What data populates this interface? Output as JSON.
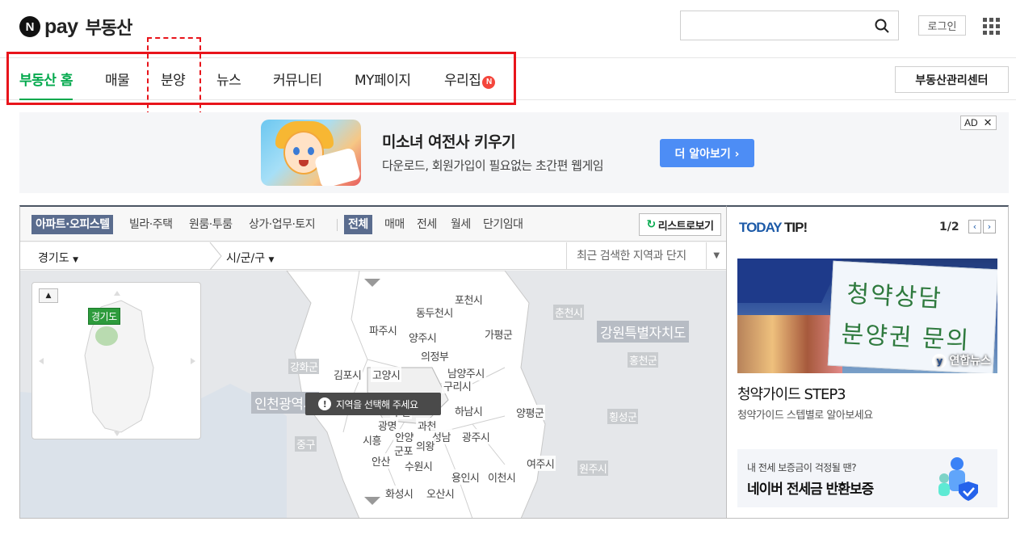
{
  "header": {
    "logo_n": "N",
    "logo_pay": "pay",
    "logo_service": "부동산",
    "search_placeholder": "",
    "login": "로그인"
  },
  "nav": {
    "items": [
      "부동산 홈",
      "매물",
      "분양",
      "뉴스",
      "커뮤니티",
      "MY페이지",
      "우리집"
    ],
    "active_index": 0,
    "badge": "N",
    "management_center": "부동산관리센터"
  },
  "ad": {
    "title": "미소녀 여전사 키우기",
    "description": "다운로드, 회원가입이 필요없는 초간편 웹게임",
    "cta": "더 알아보기 ›",
    "badge": "AD",
    "close": "✕"
  },
  "map_panel": {
    "filters_type": [
      "아파트·오피스텔",
      "빌라·주택",
      "원룸·투룸",
      "상가·업무·토지"
    ],
    "filters_deal": [
      "전체",
      "매매",
      "전세",
      "월세",
      "단기임대"
    ],
    "list_button": "리스트로보기",
    "list_icon": "↻",
    "province": "경기도",
    "city": "시/군/구",
    "recent_search": "최근 검색한 지역과 단지",
    "mini_map_tag": "경기도",
    "mini_map_up": "▲",
    "tooltip": "지역을 선택해 주세요",
    "tooltip_icon": "!",
    "cities": {
      "pocheon": "포천시",
      "dongducheon": "동두천시",
      "paju": "파주시",
      "yangju": "양주시",
      "gapyeong": "가평군",
      "uijeongbu": "의정부",
      "gimpo": "김포시",
      "goyang": "고양시",
      "namyangju": "남양주시",
      "guri": "구리시",
      "hanam": "하남시",
      "yangpyeong": "양평군",
      "gwangmyeong": "광명",
      "gwacheon": "과천",
      "siheung": "시흥",
      "anyang": "안양",
      "seongnam": "성남",
      "gwangju": "광주시",
      "gunpo": "군포",
      "uiwang": "의왕",
      "ansan": "안산",
      "suwon": "수원시",
      "yongin": "용인시",
      "icheon": "이천시",
      "yeoju": "여주시",
      "hwaseong": "화성시",
      "osan": "오산시",
      "chuncheon": "춘천시",
      "gangwon": "강원특별자치도",
      "hongcheon": "홍천군",
      "hoengseong": "횡성군",
      "wonju": "원주시",
      "ganghwa": "강화군",
      "incheon": "인천광역시",
      "junggu": "중구",
      "bucheon": "부천"
    }
  },
  "tip": {
    "title_a": "TODAY",
    "title_b": " TIP!",
    "page": "1/2",
    "prev": "‹",
    "next": "›",
    "photo_line1": "청약상담",
    "photo_line2": "분양권 문의",
    "photo_watermark": "연합뉴스",
    "photo_watermark_icon": "y",
    "headline": "청약가이드 STEP3",
    "subtitle": "청약가이드 스텝별로 알아보세요",
    "banner_line1": "내 전세 보증금이 걱정될 땐?",
    "banner_line2": "네이버 전세금 반환보증"
  }
}
